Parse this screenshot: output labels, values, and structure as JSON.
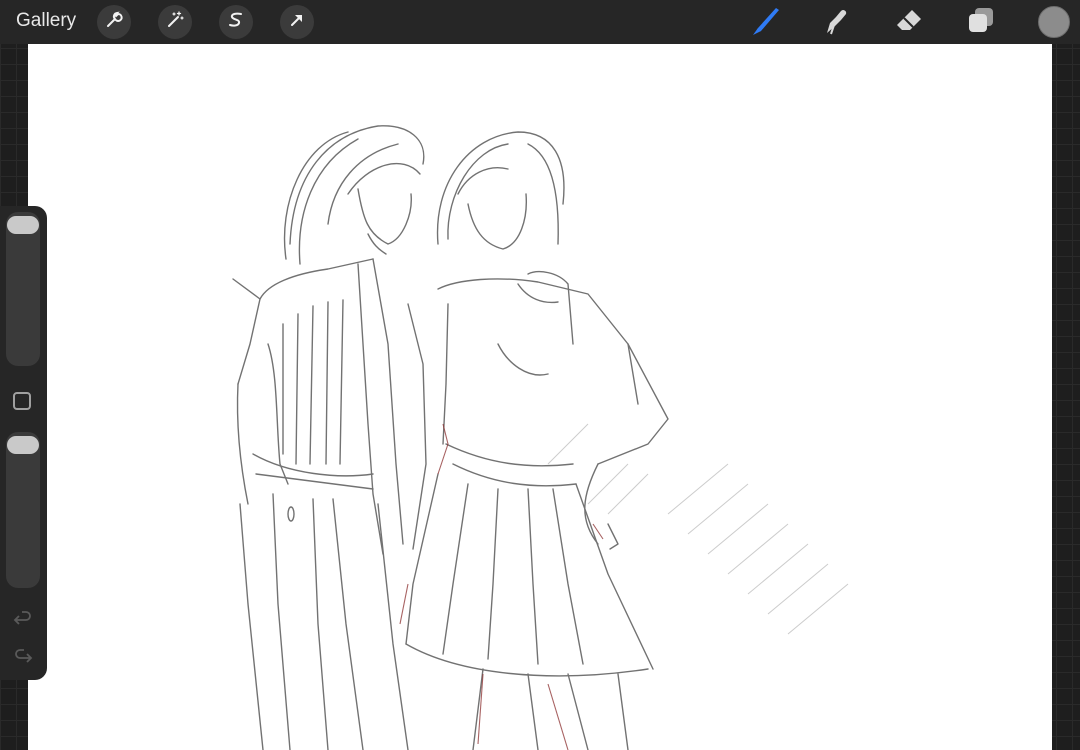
{
  "topbar": {
    "gallery_label": "Gallery",
    "actions": [
      "wrench-icon",
      "magic-wand-icon",
      "selection-s-icon",
      "transform-arrow-icon"
    ],
    "tools": [
      "brush-icon",
      "smudge-icon",
      "eraser-icon",
      "layers-icon"
    ],
    "active_tool": "brush",
    "accent_color": "#2f7bf5",
    "current_color": "#8c8c8c"
  },
  "sidebar": {
    "brush_size_level": 0.0,
    "opacity_level": 0.0,
    "controls": [
      "brush-size-slider",
      "modify-button",
      "opacity-slider",
      "undo-icon",
      "redo-icon"
    ]
  },
  "canvas": {
    "background": "#ffffff",
    "stroke_color": "#555555",
    "accent_stroke_color": "#8b2f2f"
  }
}
